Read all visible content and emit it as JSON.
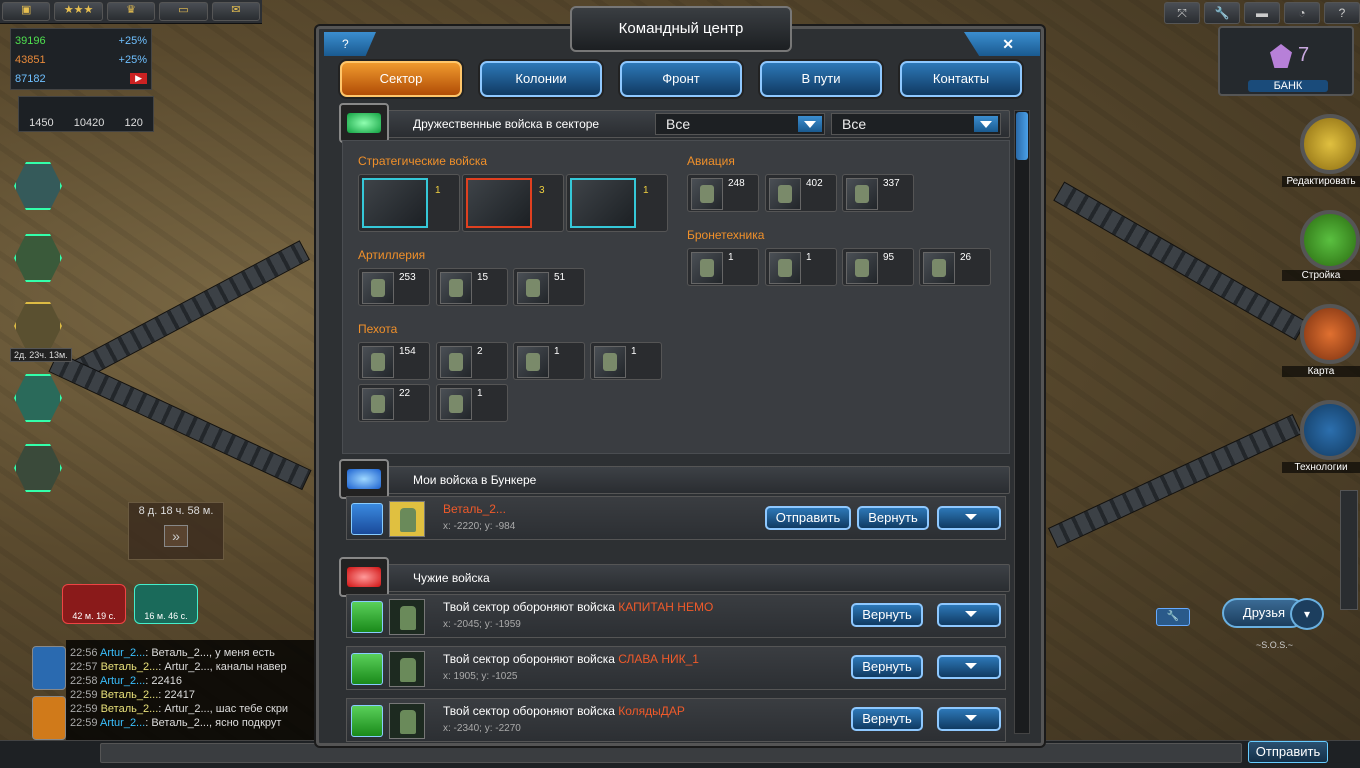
{
  "hud": {
    "resources": {
      "credits": "39196",
      "credits_rate": "+25%",
      "titan": "43851",
      "titan_rate": "+25%",
      "money": "87182"
    },
    "counters": [
      "1450",
      "10420",
      "120"
    ],
    "timer_small": "2д. 23ч. 13м.",
    "build_timer": "8 д. 18 ч. 58 м.",
    "pill_red": "42 м. 19 с.",
    "pill_green": "16 м. 46 с.",
    "bank_value": "7",
    "bank_label": "БАНК",
    "right_buttons": [
      "Редактировать",
      "Стройка",
      "Карта",
      "Технологии"
    ],
    "friends": "Друзья",
    "sos": "~S.O.S.~",
    "send": "Отправить"
  },
  "chat": [
    {
      "time": "22:56",
      "name": "Artur_2...",
      "nc": "n1",
      "msg": ": Веталь_2..., у меня есть"
    },
    {
      "time": "22:57",
      "name": "Веталь_2...",
      "nc": "n2",
      "msg": ": Artur_2..., каналы навер"
    },
    {
      "time": "22:58",
      "name": "Artur_2...",
      "nc": "n1",
      "msg": ": 22416"
    },
    {
      "time": "22:59",
      "name": "Веталь_2...",
      "nc": "n2",
      "msg": ": 22417"
    },
    {
      "time": "22:59",
      "name": "Веталь_2...",
      "nc": "n2",
      "msg": ": Artur_2..., шас тебе скри"
    },
    {
      "time": "22:59",
      "name": "Artur_2...",
      "nc": "n1",
      "msg": ": Веталь_2..., ясно подкрут"
    }
  ],
  "dialog": {
    "title": "Командный центр",
    "help": "?",
    "close": "✕",
    "tabs": [
      "Сектор",
      "Колонии",
      "Фронт",
      "В пути",
      "Контакты"
    ],
    "friendly": {
      "title": "Дружественные войска в секторе",
      "filter1": "Все",
      "filter2": "Все",
      "categories": {
        "strategic": "Стратегические войска",
        "artillery": "Артиллерия",
        "infantry": "Пехота",
        "aviation": "Авиация",
        "armor": "Бронетехника"
      },
      "strategic_units": [
        "1",
        "3",
        "1"
      ],
      "artillery_units": [
        "253",
        "15",
        "51"
      ],
      "infantry_units": [
        "154",
        "2",
        "1",
        "1",
        "22",
        "1"
      ],
      "aviation_units": [
        "248",
        "402",
        "337"
      ],
      "armor_units": [
        "1",
        "1",
        "95",
        "26"
      ]
    },
    "bunker": {
      "title": "Мои войска в Бункере",
      "name": "Веталь_2...",
      "coords": "x: -2220; y: -984",
      "send": "Отправить",
      "return": "Вернуть"
    },
    "foreign": {
      "title": "Чужие войска",
      "prefix": "Твой сектор обороняют войска",
      "return": "Вернуть",
      "rows": [
        {
          "name": "КАПИТАН НЕМО",
          "coords": "x: -2045; y: -1959"
        },
        {
          "name": "СЛАВА НИК_1",
          "coords": "x: 1905; y: -1025"
        },
        {
          "name": "КолядыДАР",
          "coords": "x: -2340; y: -2270"
        }
      ]
    }
  },
  "colors": {
    "accent_blue": "#2d78b8",
    "accent_orange": "#f09a2e",
    "name_red": "#f05a2a",
    "category": "#f0902a"
  }
}
